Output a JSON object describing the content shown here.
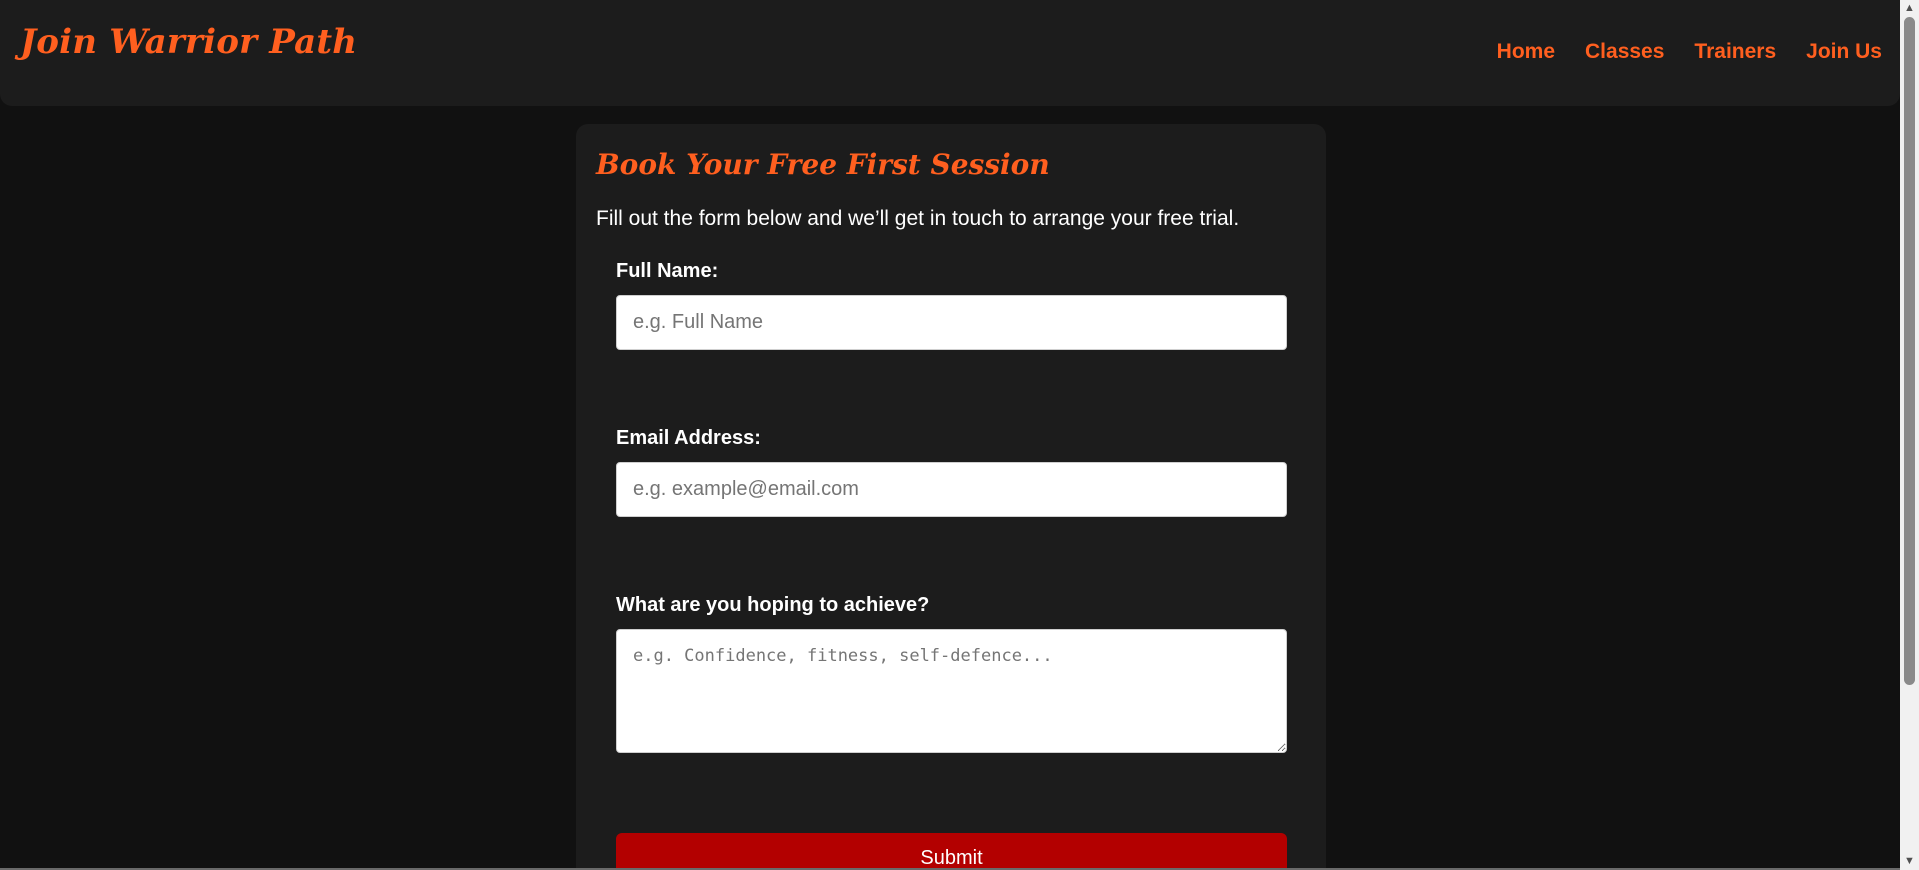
{
  "header": {
    "brand": "Join Warrior Path",
    "nav": [
      "Home",
      "Classes",
      "Trainers",
      "Join Us"
    ]
  },
  "form": {
    "title": "Book Your Free First Session",
    "intro": "Fill out the form below and we’ll get in touch to arrange your free trial.",
    "name_label": "Full Name:",
    "name_placeholder": "e.g. Full Name",
    "email_label": "Email Address:",
    "email_placeholder": "e.g. example@email.com",
    "goal_label": "What are you hoping to achieve?",
    "goal_placeholder": "e.g. Confidence, fitness, self-defence...",
    "submit_label": "Submit"
  },
  "colors": {
    "accent": "#ff5f1f",
    "submit": "#b30000",
    "background": "#111111",
    "panel": "#1c1c1c"
  },
  "icons": {
    "scroll_up": "triangle-up",
    "scroll_down": "triangle-down"
  }
}
